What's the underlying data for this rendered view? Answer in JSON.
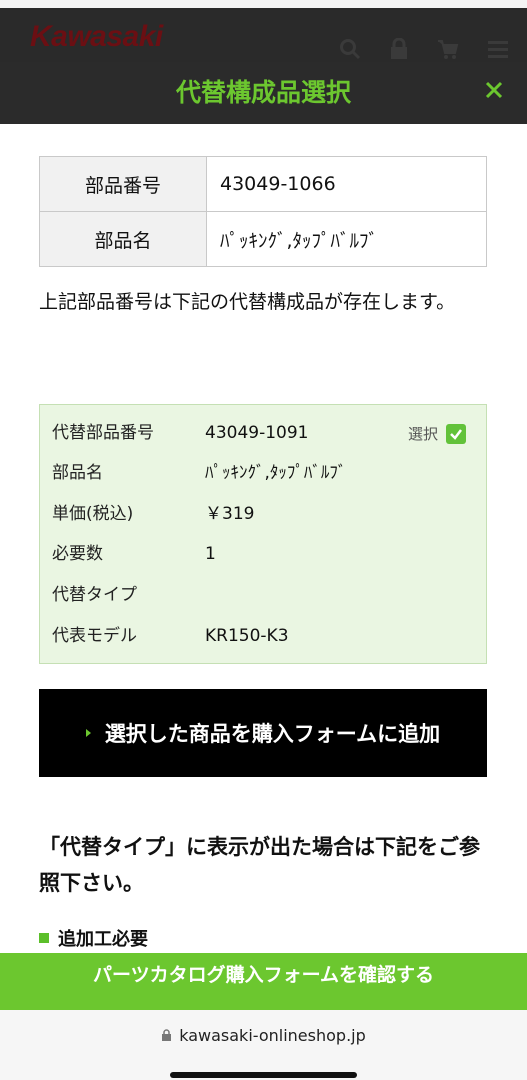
{
  "site": {
    "logo": "Kawasaki"
  },
  "header_icons": [
    "search-icon",
    "lock-icon",
    "cart-icon",
    "menu-icon"
  ],
  "modal": {
    "title": "代替構成品選択",
    "close_icon": "close-icon"
  },
  "part": {
    "number_label": "部品番号",
    "number_value": "43049-1066",
    "name_label": "部品名",
    "name_value": "ﾊﾟｯｷﾝｸﾞ,ﾀｯﾌﾟﾊﾞﾙﾌﾞ"
  },
  "notice": "上記部品番号は下記の代替構成品が存在します。",
  "alternative": {
    "select_label": "選択",
    "selected": true,
    "rows": [
      {
        "label": "代替部品番号",
        "value": "43049-1091"
      },
      {
        "label": "部品名",
        "value": "ﾊﾟｯｷﾝｸﾞ,ﾀｯﾌﾟﾊﾞﾙﾌﾞ"
      },
      {
        "label": "単価(税込)",
        "value": "￥319"
      },
      {
        "label": "必要数",
        "value": "1"
      },
      {
        "label": "代替タイプ",
        "value": ""
      },
      {
        "label": "代表モデル",
        "value": "KR150-K3"
      }
    ]
  },
  "add_button": "選択した商品を購入フォームに追加",
  "section_title": "「代替タイプ」に表示が出た場合は下記をご参照下さい。",
  "bullet_item": "追加工必要",
  "confirm_bar": "パーツカタログ購入フォームを確認する",
  "browser": {
    "url": "kawasaki-onlineshop.jp"
  },
  "colors": {
    "accent_green": "#6cc72f",
    "dark_bar": "#2b2b2b",
    "card_bg": "#eaf6e2"
  }
}
